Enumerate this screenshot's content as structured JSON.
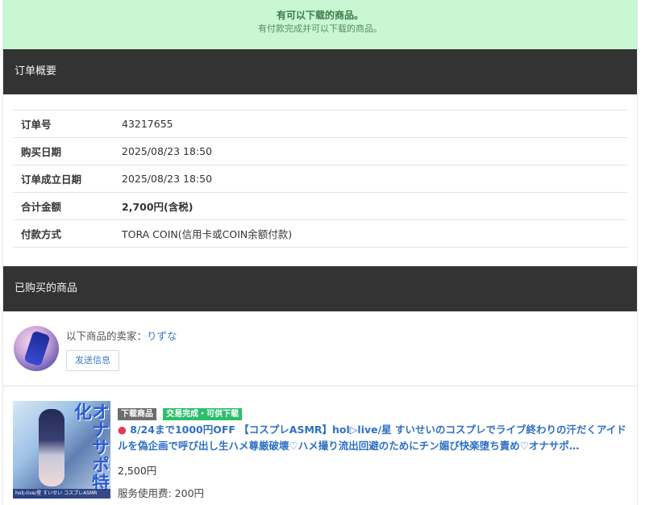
{
  "notice": {
    "title": "有可以下载的商品。",
    "subtitle": "有付款完成并可以下载的商品。"
  },
  "summary_section": {
    "header": "订单概要",
    "rows": [
      {
        "label": "订单号",
        "value": "43217655"
      },
      {
        "label": "购买日期",
        "value": "2025/08/23 18:50"
      },
      {
        "label": "订单成立日期",
        "value": "2025/08/23 18:50"
      },
      {
        "label": "合计金额",
        "value": "2,700円(含税)"
      },
      {
        "label": "付款方式",
        "value": "TORA COIN(信用卡或COIN余额付款)"
      }
    ]
  },
  "purchased_section": {
    "header": "已购买的商品",
    "seller_prefix": "以下商品的卖家：",
    "seller_name": "りずな",
    "contact_button": "发送信息"
  },
  "product": {
    "tags": [
      "下载商品",
      "交易完成・可供下载"
    ],
    "title": "8/24まで1000円OFF 【コスプレASMR】hol▷live/星 すいせいのコスプレでライブ終わりの汗だくアイドルを偽企画で呼び出し生ハメ尊厳破壊♡ハメ撮り流出回避のためにチン媚び快楽堕ち責め♡オナサポ…",
    "price": "2,500円",
    "fee": "服务使用费: 200円",
    "thumbnail_title": "オナサポ特化",
    "thumbnail_caption": "hol▷live/星 すいせい コスプレASMR"
  },
  "colors": {
    "notice_bg": "#c9f7d2",
    "header_bg": "#333333",
    "link": "#2f70c4",
    "tag_gray": "#6d6d6d",
    "tag_green": "#2bbf6b"
  }
}
